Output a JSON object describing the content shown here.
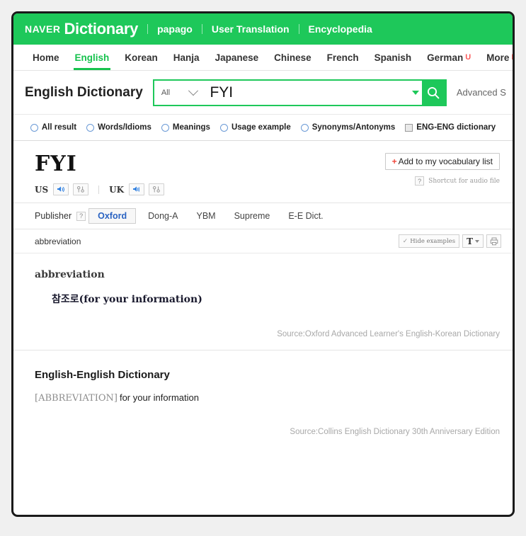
{
  "header": {
    "brand_naver": "NAVER",
    "brand_dictionary": "Dictionary",
    "links": [
      {
        "label": "papago",
        "name": "papago"
      },
      {
        "label": "User Translation",
        "name": "user-translation"
      },
      {
        "label": "Encyclopedia",
        "name": "encyclopedia"
      }
    ],
    "brand_color": "#1ec85a"
  },
  "lang_nav": {
    "items": [
      {
        "label": "Home",
        "name": "home",
        "active": false,
        "badge": ""
      },
      {
        "label": "English",
        "name": "english",
        "active": true,
        "badge": ""
      },
      {
        "label": "Korean",
        "name": "korean",
        "active": false,
        "badge": ""
      },
      {
        "label": "Hanja",
        "name": "hanja",
        "active": false,
        "badge": ""
      },
      {
        "label": "Japanese",
        "name": "japanese",
        "active": false,
        "badge": ""
      },
      {
        "label": "Chinese",
        "name": "chinese",
        "active": false,
        "badge": ""
      },
      {
        "label": "French",
        "name": "french",
        "active": false,
        "badge": ""
      },
      {
        "label": "Spanish",
        "name": "spanish",
        "active": false,
        "badge": ""
      },
      {
        "label": "German",
        "name": "german",
        "active": false,
        "badge": "U"
      },
      {
        "label": "More",
        "name": "more",
        "active": false,
        "badge": "N"
      }
    ],
    "active_color": "#17c24e",
    "badge_color": "#fb5858"
  },
  "search": {
    "dict_title": "English Dictionary",
    "scope_value": "All",
    "query_value": "FYI",
    "query_placeholder": "",
    "search_icon": "magnifier-icon",
    "advanced_label": "Advanced S"
  },
  "filters": {
    "radios": [
      {
        "label": "All result",
        "name": "all-result"
      },
      {
        "label": "Words/Idioms",
        "name": "words-idioms"
      },
      {
        "label": "Meanings",
        "name": "meanings"
      },
      {
        "label": "Usage example",
        "name": "usage-example"
      },
      {
        "label": "Synonyms/Antonyms",
        "name": "synonyms-antonyms"
      }
    ],
    "checkbox": {
      "label": "ENG-ENG dictionary",
      "name": "eng-eng-dictionary",
      "checked": false
    }
  },
  "entry": {
    "headword": "FYI",
    "pronunciations": [
      {
        "region": "US",
        "speaker_icon": "speaker-icon",
        "record_icon": "pronounce-record-icon"
      },
      {
        "region": "UK",
        "speaker_icon": "speaker-icon",
        "record_icon": "pronounce-record-icon"
      }
    ],
    "vocab_button": {
      "plus": "+",
      "label": "Add to my vocabulary list"
    },
    "shortcut": {
      "help": "?",
      "text": "Shortcut for audio file"
    }
  },
  "publisher": {
    "label": "Publisher",
    "help": "?",
    "tabs": [
      {
        "label": "Oxford",
        "name": "oxford",
        "selected": true
      },
      {
        "label": "Dong-A",
        "name": "dong-a",
        "selected": false
      },
      {
        "label": "YBM",
        "name": "ybm",
        "selected": false
      },
      {
        "label": "Supreme",
        "name": "supreme",
        "selected": false
      },
      {
        "label": "E-E Dict.",
        "name": "e-e-dict",
        "selected": false
      }
    ],
    "selected_color": "#2a63c2"
  },
  "pos_toolbar": {
    "pos_label": "abbreviation",
    "hide_examples": {
      "check": "✓",
      "label": "Hide examples"
    },
    "font_size": {
      "label": "T",
      "caret": "▾"
    },
    "print_icon": "printer-icon"
  },
  "definition": {
    "pos": "abbreviation",
    "text": "참조로(for your information)",
    "source": "Source:Oxford Advanced Learner's English-Korean Dictionary"
  },
  "ee_dictionary": {
    "title": "English-English Dictionary",
    "tag": "[ABBREVIATION]",
    "text": "for your information",
    "source": "Source:Collins English Dictionary 30th Anniversary Edition"
  }
}
